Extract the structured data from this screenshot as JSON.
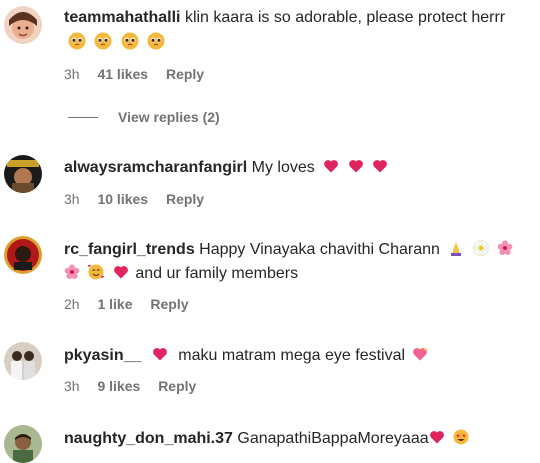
{
  "comments": [
    {
      "username": "teammahathalli",
      "text": "klin kaara is so adorable, please protect herrr",
      "time": "3h",
      "likes": "41 likes",
      "reply": "Reply",
      "view_replies": "View replies (2)"
    },
    {
      "username": "alwaysramcharanfangirl",
      "text": "My loves",
      "time": "3h",
      "likes": "10 likes",
      "reply": "Reply"
    },
    {
      "username": "rc_fangirl_trends",
      "text": "Happy Vinayaka chavithi Charann",
      "text2": "and ur family members",
      "time": "2h",
      "likes": "1 like",
      "reply": "Reply"
    },
    {
      "username": "pkyasin__",
      "text": "maku matram mega eye festival",
      "time": "3h",
      "likes": "9 likes",
      "reply": "Reply"
    },
    {
      "username": "naughty_don_mahi.37",
      "text": "GanapathiBappaMoreyaaa"
    }
  ],
  "colors": {
    "text": "#262626",
    "meta": "#737373",
    "heart": "#e0245e"
  },
  "icons": [
    "pleading-face-emoji",
    "red-heart-emoji",
    "folded-hands-emoji",
    "white-flower-emoji",
    "cherry-blossom-emoji",
    "smiling-face-with-hearts-emoji",
    "sparkling-heart-emoji",
    "star-struck-emoji"
  ]
}
